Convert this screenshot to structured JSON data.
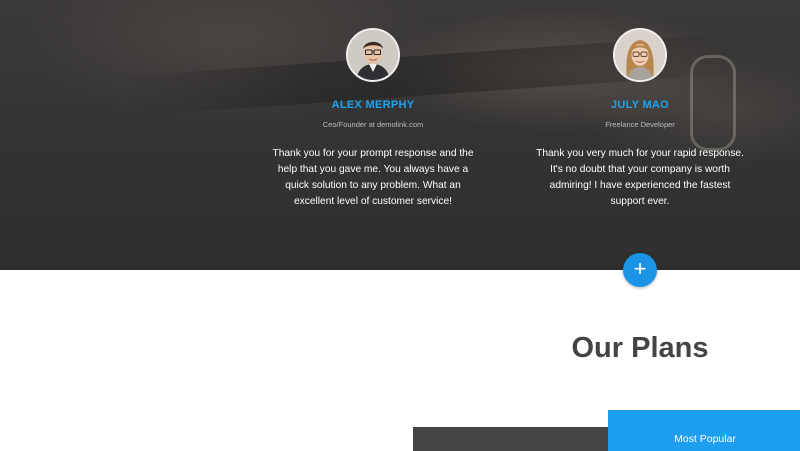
{
  "testimonials": [
    {
      "name": "ALEX MERPHY",
      "role": "Ceo/Founder at demolink.com",
      "quote": "Thank you for your prompt response and the help that you gave me. You always have a quick solution to any problem. What an excellent level of customer service!"
    },
    {
      "name": "JULY MAO",
      "role": "Freelance Developer",
      "quote": "Thank you very much for your rapid response. It's no doubt that your company is worth admiring! I have experienced the fastest support ever."
    }
  ],
  "plus_button": {
    "icon": "plus-icon",
    "glyph": "+"
  },
  "plans": {
    "title": "Our Plans",
    "popular_label": "Most Popular"
  },
  "colors": {
    "accent": "#1e9eee",
    "heading": "#444444",
    "dark_panel": "#444444"
  }
}
